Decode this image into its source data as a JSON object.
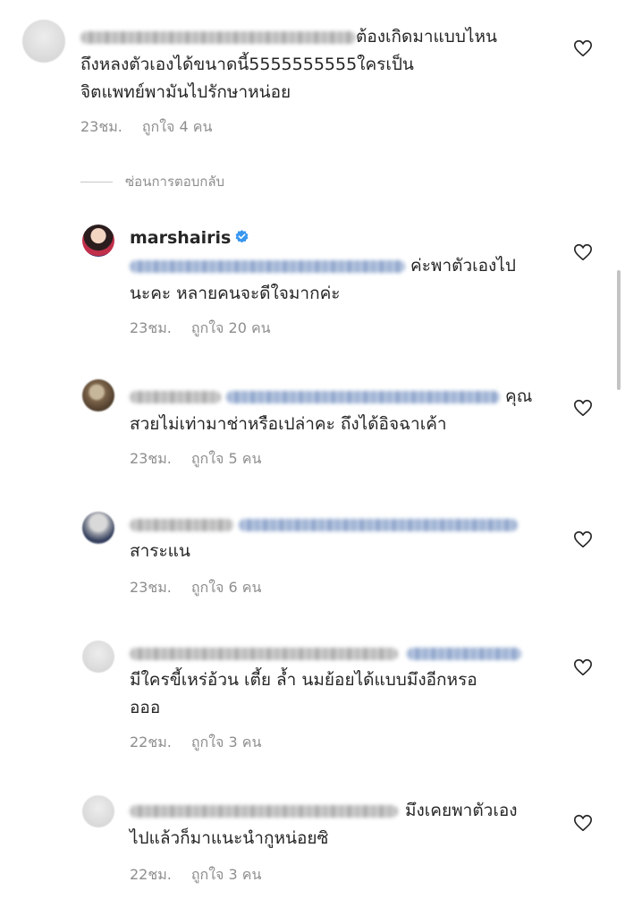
{
  "comments": [
    {
      "lines": [
        "ต้องเกิดมาแบบไหน",
        "ถึงหลงตัวเองได้ขนาดนี้5555555555ใครเป็น",
        "จิตแพทย์พามันไปรักษาหน่อย"
      ],
      "time": "23ชม.",
      "likes": "ถูกใจ 4 คน"
    },
    {
      "username": "marshairis",
      "lines": [
        "ค่ะพาตัวเองไป",
        "นะคะ หลายคนจะดีใจมากค่ะ"
      ],
      "time": "23ชม.",
      "likes": "ถูกใจ 20 คน"
    },
    {
      "lines": [
        "คุณ",
        "สวยไม่เท่ามาช่าหรือเปล่าคะ ถึงได้อิจฉาเค้า"
      ],
      "time": "23ชม.",
      "likes": "ถูกใจ 5 คน"
    },
    {
      "lines": [
        "สาระแน"
      ],
      "time": "23ชม.",
      "likes": "ถูกใจ 6 คน"
    },
    {
      "lines": [
        "มีใครขี้เหร่อ้วน เตี้ย ล้ำ นมย้อยได้แบบมึงอีกหรอ",
        "อออ"
      ],
      "time": "22ชม.",
      "likes": "ถูกใจ 3 คน"
    },
    {
      "lines": [
        "มึงเคยพาตัวเอง",
        "ไปแล้วก็มาแนะนำกูหน่อยซิ"
      ],
      "time": "22ชม.",
      "likes": "ถูกใจ 3 คน"
    }
  ],
  "hide_replies_label": "ซ่อนการตอบกลับ",
  "icons": {
    "like": "heart-outline-icon",
    "verified": "verified-badge-icon"
  },
  "colors": {
    "text": "#262626",
    "secondary": "#8e8e8e",
    "verified": "#3897f0",
    "mention": "#00376b"
  }
}
